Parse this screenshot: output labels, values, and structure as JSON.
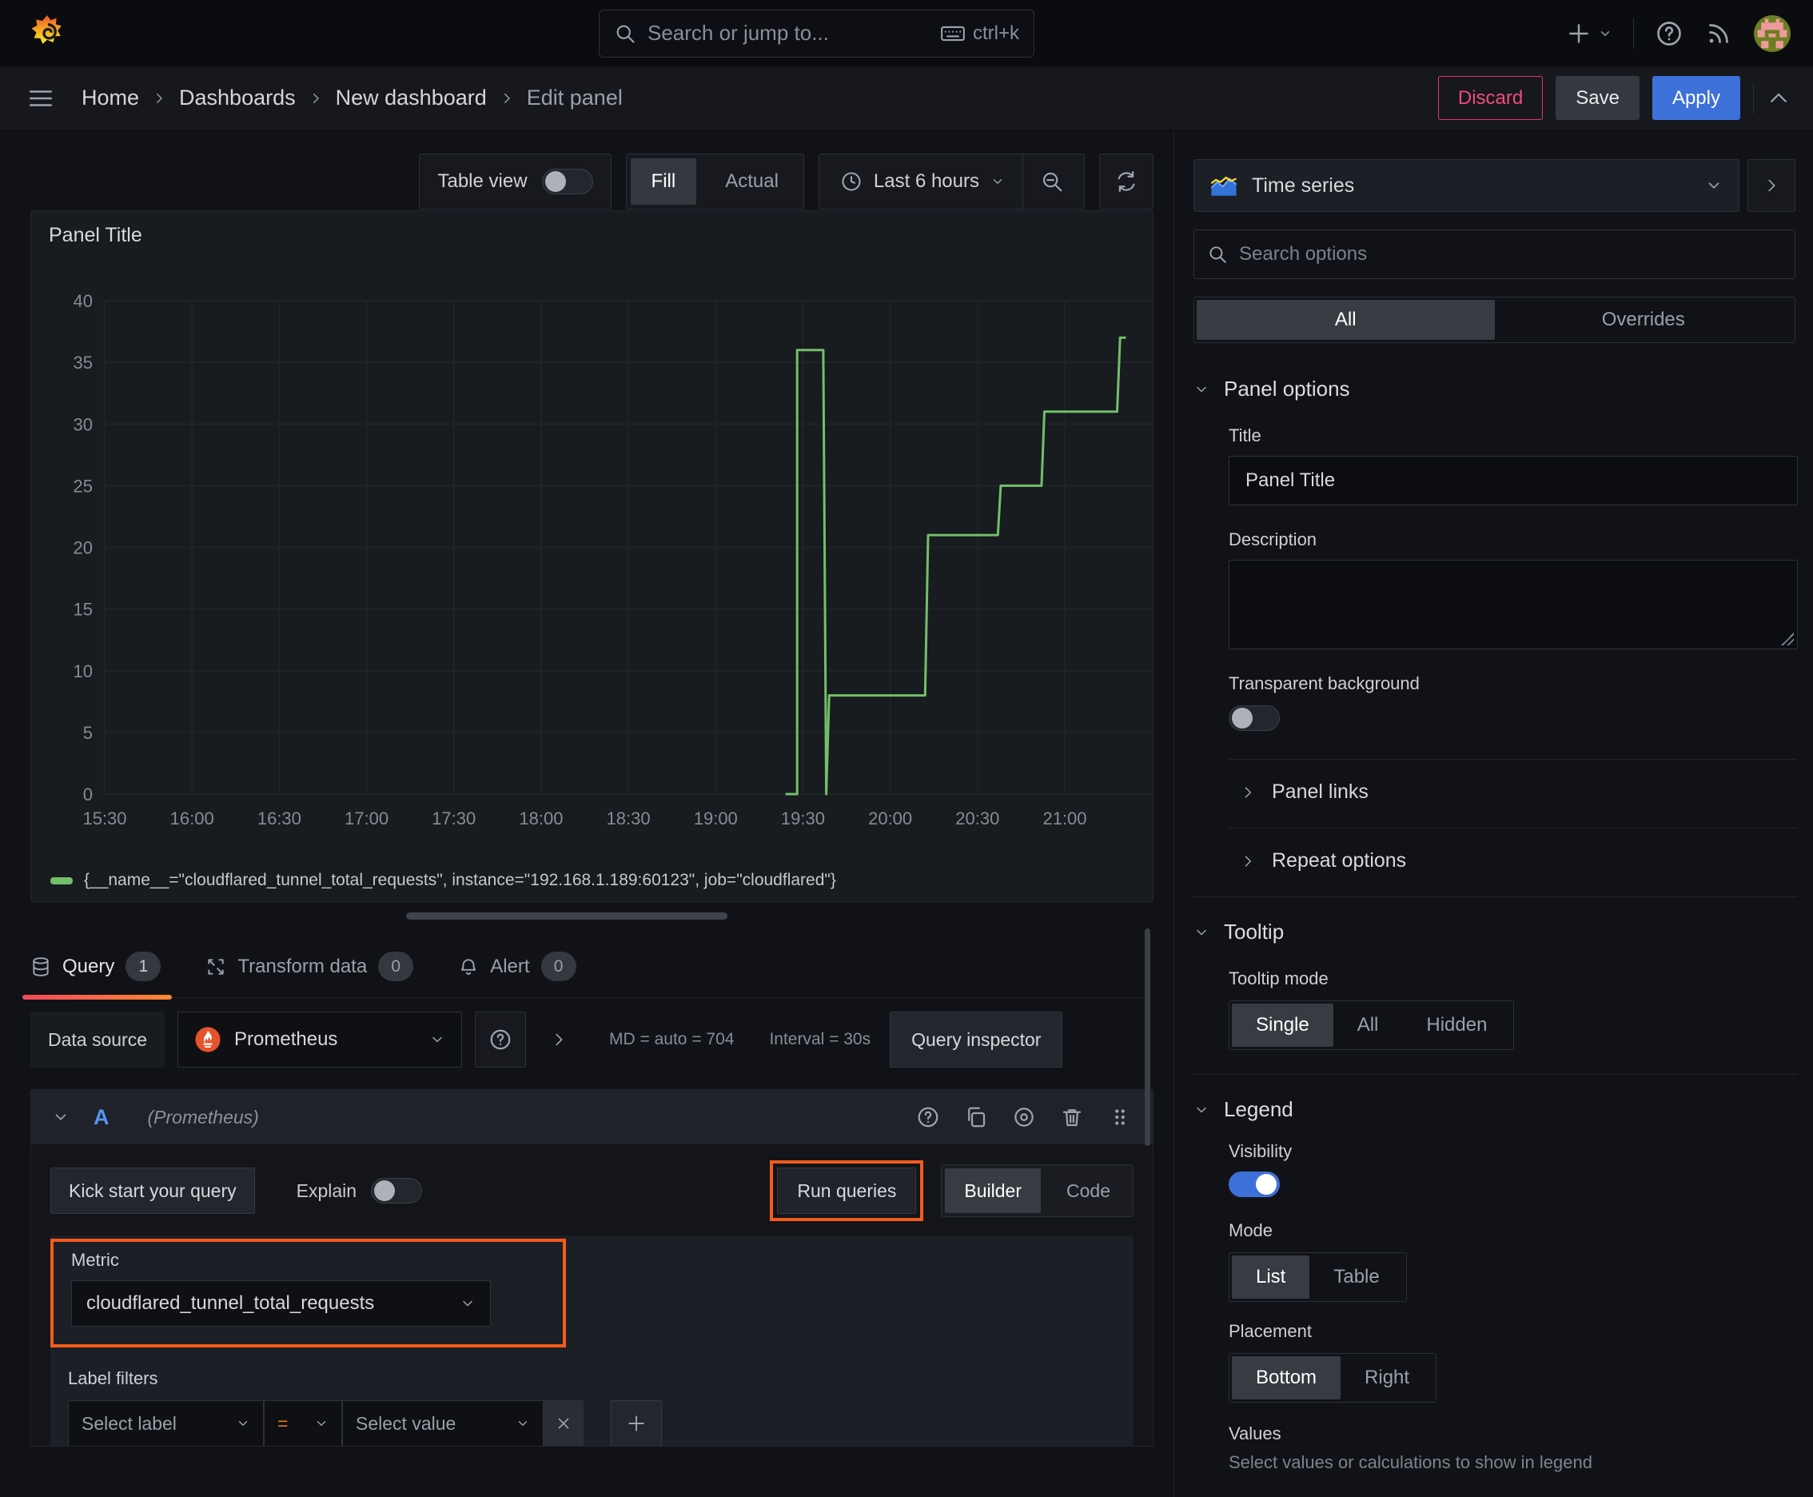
{
  "topnav": {
    "search_placeholder": "Search or jump to...",
    "shortcut": "ctrl+k"
  },
  "breadcrumbs": {
    "items": [
      "Home",
      "Dashboards",
      "New dashboard",
      "Edit panel"
    ]
  },
  "actions": {
    "discard": "Discard",
    "save": "Save",
    "apply": "Apply"
  },
  "toolbar": {
    "table_view": "Table view",
    "fill": "Fill",
    "actual": "Actual",
    "time_range": "Last 6 hours"
  },
  "panel": {
    "title": "Panel Title",
    "legend": "{__name__=\"cloudflared_tunnel_total_requests\", instance=\"192.168.1.189:60123\", job=\"cloudflared\"}"
  },
  "chart_data": {
    "type": "line",
    "title": "Panel Title",
    "line_style": "step-after",
    "grid": true,
    "legend_position": "bottom",
    "x_ticks": [
      "15:30",
      "16:00",
      "16:30",
      "17:00",
      "17:30",
      "18:00",
      "18:30",
      "19:00",
      "19:30",
      "20:00",
      "20:30",
      "21:00"
    ],
    "x_range": [
      "15:29",
      "21:30"
    ],
    "y_ticks": [
      0,
      5,
      10,
      15,
      20,
      25,
      30,
      35,
      40
    ],
    "ylim": [
      0,
      40
    ],
    "series": [
      {
        "name": "{__name__=\"cloudflared_tunnel_total_requests\", instance=\"192.168.1.189:60123\", job=\"cloudflared\"}",
        "color": "#73bf69",
        "points": [
          [
            "19:24",
            0
          ],
          [
            "19:28",
            0
          ],
          [
            "19:28",
            36
          ],
          [
            "19:37",
            36
          ],
          [
            "19:38",
            0
          ],
          [
            "19:39",
            8
          ],
          [
            "20:12",
            8
          ],
          [
            "20:13",
            21
          ],
          [
            "20:37",
            21
          ],
          [
            "20:38",
            25
          ],
          [
            "20:52",
            25
          ],
          [
            "20:53",
            31
          ],
          [
            "21:18",
            31
          ],
          [
            "21:19",
            37
          ],
          [
            "21:21",
            37
          ]
        ]
      }
    ]
  },
  "tabs": {
    "query": "Query",
    "query_count": "1",
    "transform": "Transform data",
    "transform_count": "0",
    "alert": "Alert",
    "alert_count": "0"
  },
  "datasource": {
    "label": "Data source",
    "name": "Prometheus",
    "stats_md": "MD = auto = 704",
    "stats_interval": "Interval = 30s",
    "inspector": "Query inspector"
  },
  "query_editor": {
    "ref_id": "A",
    "ds_hint": "(Prometheus)",
    "kick_start": "Kick start your query",
    "explain": "Explain",
    "run_queries": "Run queries",
    "builder": "Builder",
    "code": "Code",
    "metric_label": "Metric",
    "metric_value": "cloudflared_tunnel_total_requests",
    "label_filters": "Label filters",
    "select_label": "Select label",
    "equals": "=",
    "select_value": "Select value"
  },
  "options": {
    "viz_name": "Time series",
    "search_placeholder": "Search options",
    "tab_all": "All",
    "tab_overrides": "Overrides",
    "panel_options": "Panel options",
    "title_label": "Title",
    "title_value": "Panel Title",
    "description_label": "Description",
    "transparent_bg": "Transparent background",
    "panel_links": "Panel links",
    "repeat_options": "Repeat options",
    "tooltip": "Tooltip",
    "tooltip_mode": "Tooltip mode",
    "tooltip_single": "Single",
    "tooltip_all": "All",
    "tooltip_hidden": "Hidden",
    "legend": "Legend",
    "visibility": "Visibility",
    "mode": "Mode",
    "mode_list": "List",
    "mode_table": "Table",
    "placement": "Placement",
    "placement_bottom": "Bottom",
    "placement_right": "Right",
    "values": "Values",
    "values_hint": "Select values or calculations to show in legend"
  },
  "colors": {
    "series_green": "#73bf69",
    "accent_blue": "#3d71d9",
    "refid_blue": "#5794f2",
    "discard_red": "#e23468",
    "highlight_orange": "#f25c1c",
    "equals_orange": "#eb7b18",
    "grid": "#23252b",
    "axis_text": "#878b93"
  }
}
